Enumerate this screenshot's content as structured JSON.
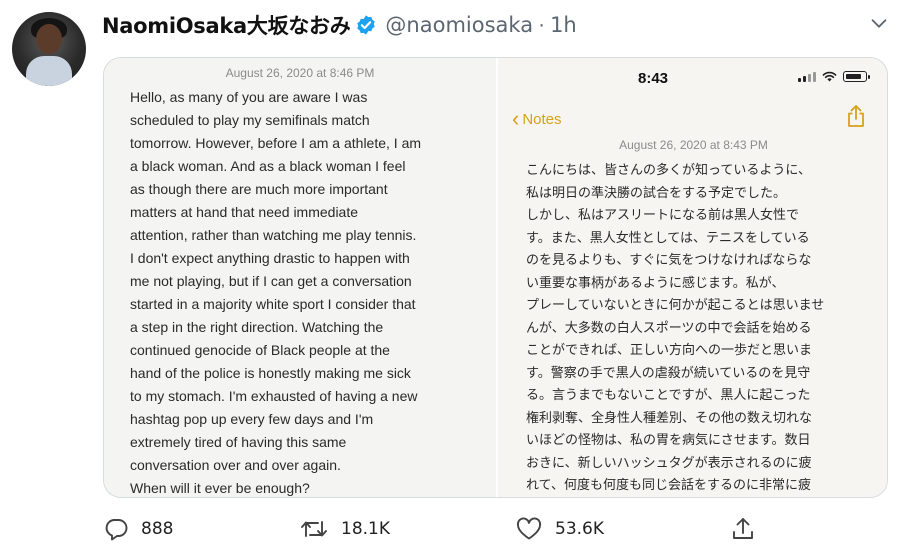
{
  "tweet": {
    "display_name": "NaomiOsaka大坂なおみ",
    "handle": "@naomiosaka",
    "separator": "·",
    "time": "1h",
    "verified_icon": "verified-badge-icon",
    "accent_color": "#1da1f2"
  },
  "media": {
    "left_note": {
      "date": "August 26, 2020 at 8:46 PM",
      "lines": [
        "Hello, as many of you are aware I was",
        "scheduled to play my semifinals match",
        "tomorrow. However, before I am a athlete, I am",
        "a black woman. And as a black woman I feel",
        "as though there are much more important",
        "matters at hand that need immediate",
        "attention, rather than watching me play tennis.",
        "I don't expect anything drastic to happen with",
        "me not playing, but if I can get a conversation",
        "started in a majority white sport I consider that",
        "a step in the right direction. Watching the",
        "continued genocide of Black people at the",
        "hand of the police is honestly making me sick",
        "to my stomach. I'm exhausted of having a new",
        "hashtag pop up every few days and I'm",
        "extremely tired of having this same",
        "conversation over and over again.",
        "When will it ever be enough?"
      ]
    },
    "right_note": {
      "status_time": "8:43",
      "back_label": "Notes",
      "accent_color": "#d6a21a",
      "date": "August 26, 2020 at 8:43 PM",
      "lines": [
        "こんにちは、皆さんの多くが知っているように、",
        "私は明日の準決勝の試合をする予定でした。",
        "しかし、私はアスリートになる前は黒人女性で",
        "す。また、黒人女性としては、テニスをしている",
        "のを見るよりも、すぐに気をつけなければならな",
        "い重要な事柄があるように感じます。私が、",
        "プレーしていないときに何かが起こるとは思いませ",
        "んが、大多数の白人スポーツの中で会話を始める",
        "ことができれば、正しい方向への一歩だと思いま",
        "す。警察の手で黒人の虐殺が続いているのを見守",
        "る。言うまでもないことですが、黒人に起こった",
        "権利剥奪、全身性人種差別、その他の数え切れな",
        "いほどの怪物は、私の胃を病気にさせます。数日",
        "おきに、新しいハッシュタグが表示されるのに疲",
        "れて、何度も何度も同じ会話をするのに非常に疲"
      ]
    }
  },
  "actions": {
    "replies": "888",
    "retweets": "18.1K",
    "likes": "53.6K"
  }
}
